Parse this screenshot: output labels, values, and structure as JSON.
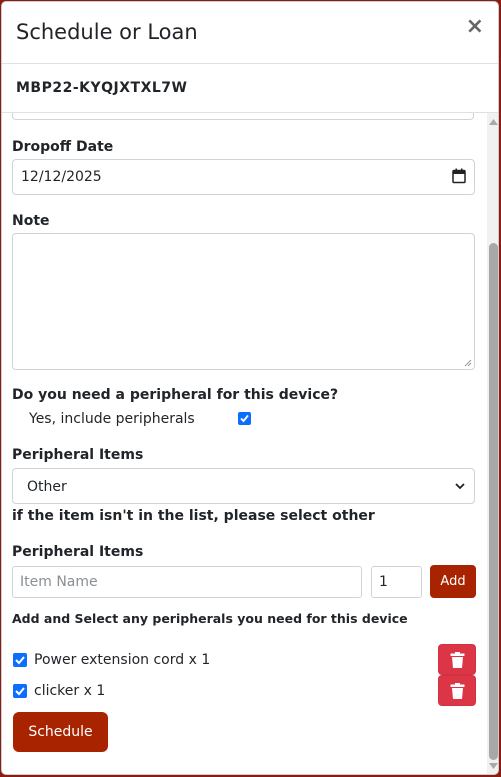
{
  "modal": {
    "title": "Schedule or Loan",
    "close_symbol": "×",
    "device_id": "MBP22-KYQJXTXL7W"
  },
  "form": {
    "dropoff_label": "Dropoff Date",
    "dropoff_value": "12/12/2025",
    "note_label": "Note",
    "peripheral_question": "Do you need a peripheral for this device?",
    "include_peripherals_label": "Yes, include peripherals",
    "include_peripherals_checked": true,
    "peripheral_items_label": "Peripheral Items",
    "peripheral_select_value": "Other",
    "select_helper": "if the item isn't in the list, please select other",
    "peripheral_items_label_2": "Peripheral Items",
    "item_name_placeholder": "Item Name",
    "quantity_value": "1",
    "add_label": "Add",
    "add_helper": "Add and Select any peripherals you need for this device",
    "schedule_label": "Schedule"
  },
  "peripherals": [
    {
      "label": "Power extension cord x 1",
      "checked": true
    },
    {
      "label": "clicker x 1",
      "checked": true
    }
  ],
  "icons": {
    "close": "close-icon",
    "calendar": "calendar-icon",
    "chevron": "chevron-down-icon",
    "trash": "trash-icon",
    "check": "checkmark-icon"
  },
  "colors": {
    "accent": "#a82400",
    "danger": "#dc3545",
    "checkbox": "#0d6efd"
  }
}
